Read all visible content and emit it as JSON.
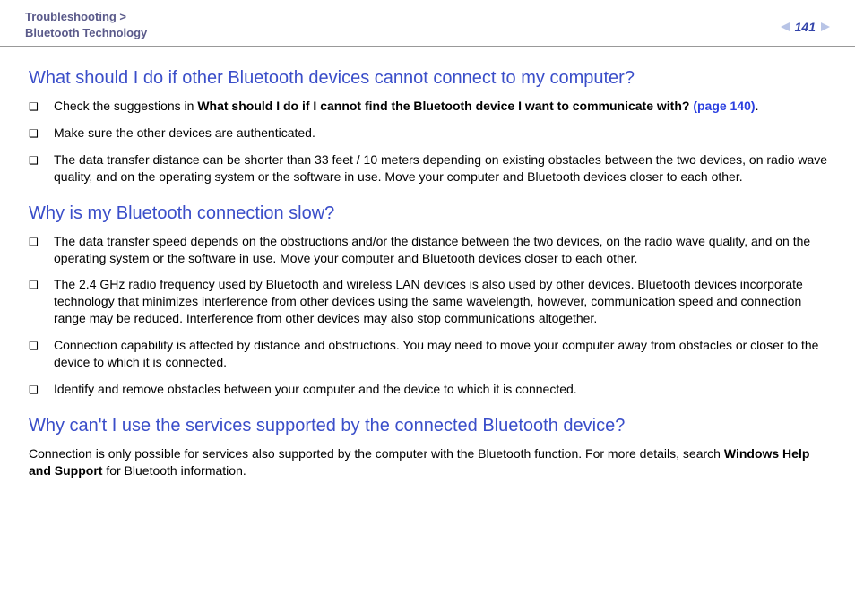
{
  "header": {
    "breadcrumb_section": "Troubleshooting >",
    "breadcrumb_sub": "Bluetooth Technology",
    "page_number": "141"
  },
  "sections": {
    "s1": {
      "title": "What should I do if other Bluetooth devices cannot connect to my computer?",
      "items": {
        "a_pre": "Check the suggestions in ",
        "a_bold": "What should I do if I cannot find the Bluetooth device I want to communicate with? ",
        "a_link": "(page 140)",
        "a_post": ".",
        "b": "Make sure the other devices are authenticated.",
        "c": "The data transfer distance can be shorter than 33 feet / 10 meters depending on existing obstacles between the two devices, on radio wave quality, and on the operating system or the software in use. Move your computer and Bluetooth devices closer to each other."
      }
    },
    "s2": {
      "title": "Why is my Bluetooth connection slow?",
      "items": {
        "a": "The data transfer speed depends on the obstructions and/or the distance between the two devices, on the radio wave quality, and on the operating system or the software in use. Move your computer and Bluetooth devices closer to each other.",
        "b": "The 2.4 GHz radio frequency used by Bluetooth and wireless LAN devices is also used by other devices. Bluetooth devices incorporate technology that minimizes interference from other devices using the same wavelength, however, communication speed and connection range may be reduced. Interference from other devices may also stop communications altogether.",
        "c": "Connection capability is affected by distance and obstructions. You may need to move your computer away from obstacles or closer to the device to which it is connected.",
        "d": "Identify and remove obstacles between your computer and the device to which it is connected."
      }
    },
    "s3": {
      "title": "Why can't I use the services supported by the connected Bluetooth device?",
      "para_pre": "Connection is only possible for services also supported by the computer with the Bluetooth function. For more details, search ",
      "para_bold": "Windows Help and Support",
      "para_post": " for Bluetooth information."
    }
  }
}
